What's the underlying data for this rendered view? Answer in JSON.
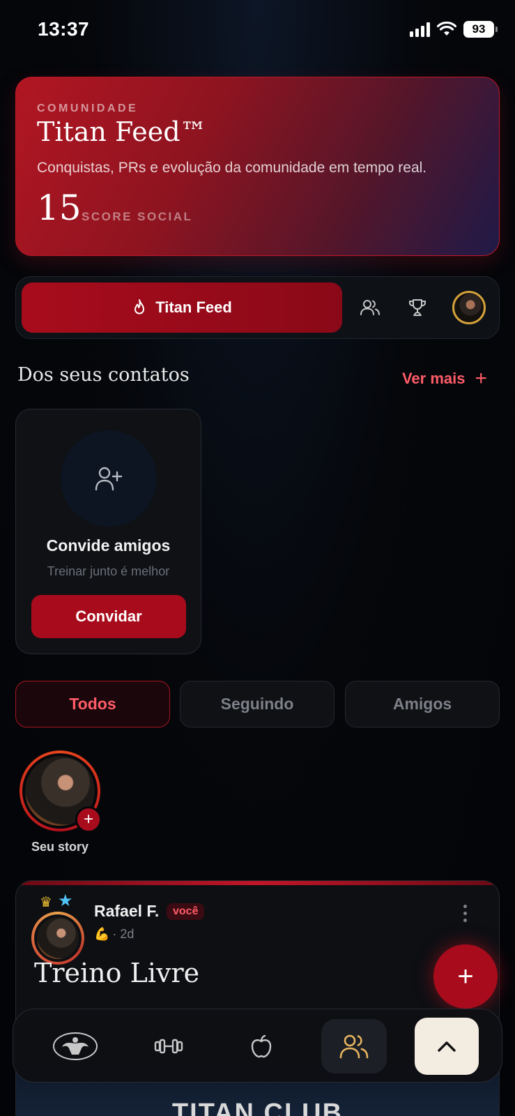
{
  "status_bar": {
    "time": "13:37",
    "battery": "93"
  },
  "hero": {
    "eyebrow": "COMUNIDADE",
    "title": "Titan Feed™",
    "subtitle": "Conquistas, PRs e evolução da comunidade em tempo real.",
    "score": "15",
    "score_label": "SCORE SOCIAL"
  },
  "segment_nav": {
    "active_label": "Titan Feed",
    "icons": [
      "flame-icon",
      "users-icon",
      "trophy-icon",
      "avatar"
    ]
  },
  "contacts": {
    "title": "Dos seus contatos",
    "more_label": "Ver mais",
    "invite": {
      "title": "Convide amigos",
      "subtitle": "Treinar junto é melhor",
      "button": "Convidar"
    }
  },
  "filter_tabs": [
    {
      "label": "Todos",
      "active": true
    },
    {
      "label": "Seguindo",
      "active": false
    },
    {
      "label": "Amigos",
      "active": false
    }
  ],
  "story": {
    "label": "Seu story"
  },
  "post": {
    "author": "Rafael F.",
    "badge": "você",
    "emoji": "💪",
    "time": "· 2d",
    "title": "Treino Livre",
    "image_text": "TITAN CLUB"
  },
  "fab": {
    "label": "+"
  },
  "bottom_nav": {
    "items": [
      "logo-icon",
      "dumbbell-icon",
      "apple-icon",
      "users-icon"
    ],
    "active_index": 3
  },
  "colors": {
    "accent": "#a80c1c",
    "accent_text": "#ff5c68",
    "background": "#05070b",
    "gold": "#d4a23a"
  }
}
